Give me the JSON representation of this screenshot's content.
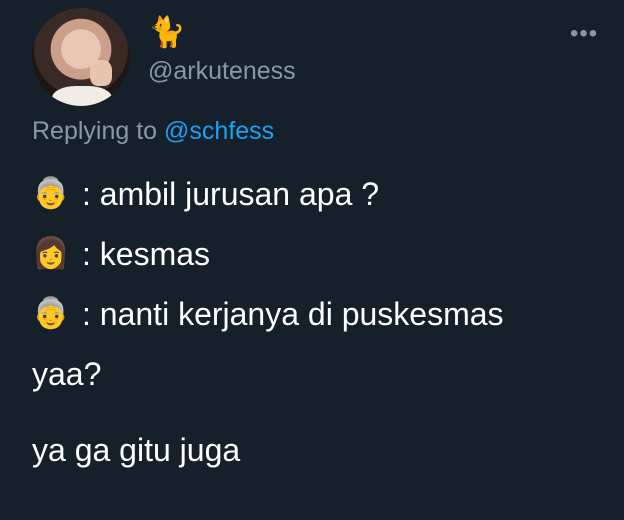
{
  "user": {
    "display_name": "🐈",
    "handle": "@arkuteness"
  },
  "more_icon": "•••",
  "reply": {
    "prefix": "Replying to",
    "mention": "@schfess"
  },
  "body": {
    "lines": [
      {
        "emoji": "👵",
        "text": ": ambil jurusan apa ?"
      },
      {
        "emoji": "👩",
        "text": ": kesmas"
      },
      {
        "emoji": "👵",
        "text": ": nanti kerjanya di puskesmas"
      }
    ],
    "wrap": "yaa?",
    "answer": "ya ga gitu juga"
  },
  "colors": {
    "background": "#15202b",
    "secondary_text": "#8899a6",
    "link": "#1da1f2"
  }
}
